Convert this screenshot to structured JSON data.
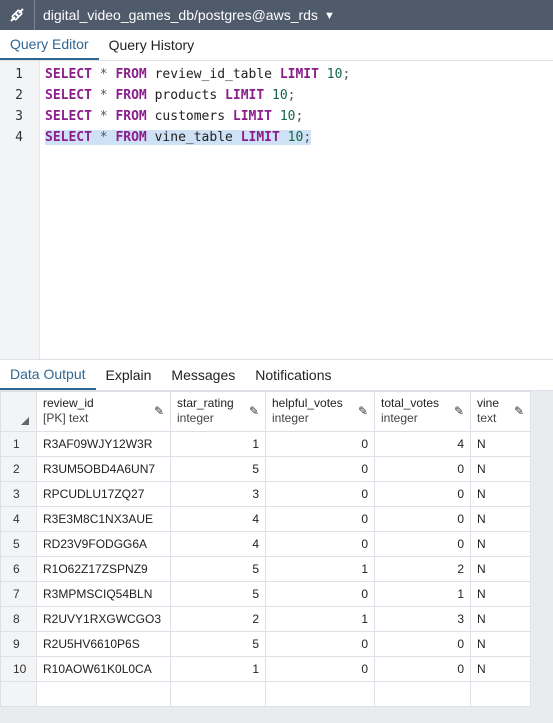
{
  "connection": {
    "title": "digital_video_games_db/postgres@aws_rds"
  },
  "editor_tabs": [
    {
      "label": "Query Editor"
    },
    {
      "label": "Query History"
    }
  ],
  "editor": {
    "lines": [
      {
        "num": "1",
        "table": "review_id_table",
        "limit": "10"
      },
      {
        "num": "2",
        "table": "products",
        "limit": "10"
      },
      {
        "num": "3",
        "table": "customers",
        "limit": "10"
      },
      {
        "num": "4",
        "table": "vine_table",
        "limit": "10"
      }
    ],
    "kw_select": "SELECT",
    "star": "*",
    "kw_from": "FROM",
    "kw_limit": "LIMIT",
    "semicolon": ";"
  },
  "output_tabs": [
    {
      "label": "Data Output"
    },
    {
      "label": "Explain"
    },
    {
      "label": "Messages"
    },
    {
      "label": "Notifications"
    }
  ],
  "grid": {
    "columns": [
      {
        "name": "review_id",
        "type": "[PK] text"
      },
      {
        "name": "star_rating",
        "type": "integer"
      },
      {
        "name": "helpful_votes",
        "type": "integer"
      },
      {
        "name": "total_votes",
        "type": "integer"
      },
      {
        "name": "vine",
        "type": "text"
      }
    ],
    "rows": [
      {
        "n": "1",
        "review_id": "R3AF09WJY12W3R",
        "star_rating": "1",
        "helpful_votes": "0",
        "total_votes": "4",
        "vine": "N"
      },
      {
        "n": "2",
        "review_id": "R3UM5OBD4A6UN7",
        "star_rating": "5",
        "helpful_votes": "0",
        "total_votes": "0",
        "vine": "N"
      },
      {
        "n": "3",
        "review_id": "RPCUDLU17ZQ27",
        "star_rating": "3",
        "helpful_votes": "0",
        "total_votes": "0",
        "vine": "N"
      },
      {
        "n": "4",
        "review_id": "R3E3M8C1NX3AUE",
        "star_rating": "4",
        "helpful_votes": "0",
        "total_votes": "0",
        "vine": "N"
      },
      {
        "n": "5",
        "review_id": "RD23V9FODGG6A",
        "star_rating": "4",
        "helpful_votes": "0",
        "total_votes": "0",
        "vine": "N"
      },
      {
        "n": "6",
        "review_id": "R1O62Z17ZSPNZ9",
        "star_rating": "5",
        "helpful_votes": "1",
        "total_votes": "2",
        "vine": "N"
      },
      {
        "n": "7",
        "review_id": "R3MPMSCIQ54BLN",
        "star_rating": "5",
        "helpful_votes": "0",
        "total_votes": "1",
        "vine": "N"
      },
      {
        "n": "8",
        "review_id": "R2UVY1RXGWCGO3",
        "star_rating": "2",
        "helpful_votes": "1",
        "total_votes": "3",
        "vine": "N"
      },
      {
        "n": "9",
        "review_id": "R2U5HV6610P6S",
        "star_rating": "5",
        "helpful_votes": "0",
        "total_votes": "0",
        "vine": "N"
      },
      {
        "n": "10",
        "review_id": "R10AOW61K0L0CA",
        "star_rating": "1",
        "helpful_votes": "0",
        "total_votes": "0",
        "vine": "N"
      }
    ]
  },
  "colors": {
    "topbar": "#4f5b6b",
    "active_tab": "#326690",
    "keyword": "#8b1e8b",
    "number": "#116644",
    "selection": "#cfe1f5"
  }
}
